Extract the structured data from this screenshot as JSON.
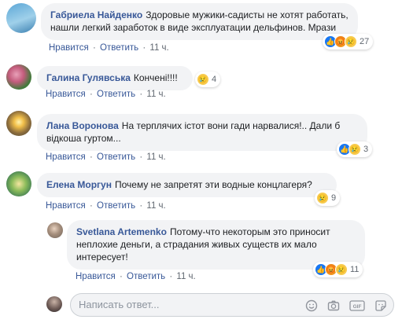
{
  "comments": [
    {
      "author": "Габриела Найденко",
      "text": "Здоровые мужики-садисты не хотят работать, нашли легкий заработок в виде эксплуатации дельфинов. Мрази",
      "like_label": "Нравится",
      "reply_label": "Ответить",
      "time": "11 ч.",
      "reactions": [
        "like",
        "angry",
        "sad"
      ],
      "reaction_count": "27"
    },
    {
      "author": "Галина Гулявська",
      "text": "Кончені!!!!",
      "like_label": "Нравится",
      "reply_label": "Ответить",
      "time": "11 ч.",
      "reactions": [
        "sad"
      ],
      "reaction_count": "4"
    },
    {
      "author": "Лана Воронова",
      "text": "На терплячих істот вони гади нарвалися!.. Дали б відкоша гуртом...",
      "like_label": "Нравится",
      "reply_label": "Ответить",
      "time": "11 ч.",
      "reactions": [
        "like",
        "sad"
      ],
      "reaction_count": "3"
    },
    {
      "author": "Елена Моргун",
      "text": "Почему не запретят эти водные концлагеря?",
      "like_label": "Нравится",
      "reply_label": "Ответить",
      "time": "11 ч.",
      "reactions": [
        "sad"
      ],
      "reaction_count": "9"
    },
    {
      "author": "Svetlana Artemenko",
      "text": "Потому-что некоторым это приносит неплохие деньги, а страдания живых существ их мало интересует!",
      "like_label": "Нравится",
      "reply_label": "Ответить",
      "time": "11 ч.",
      "reactions": [
        "like",
        "angry",
        "sad"
      ],
      "reaction_count": "11"
    }
  ],
  "separator": "·",
  "composer": {
    "placeholder": "Написать ответ...",
    "icons": [
      "smile-icon",
      "camera-icon",
      "gif-icon",
      "sticker-icon"
    ]
  },
  "colors": {
    "link": "#385898",
    "bubble": "#f2f3f5",
    "like": "#1877f2"
  }
}
